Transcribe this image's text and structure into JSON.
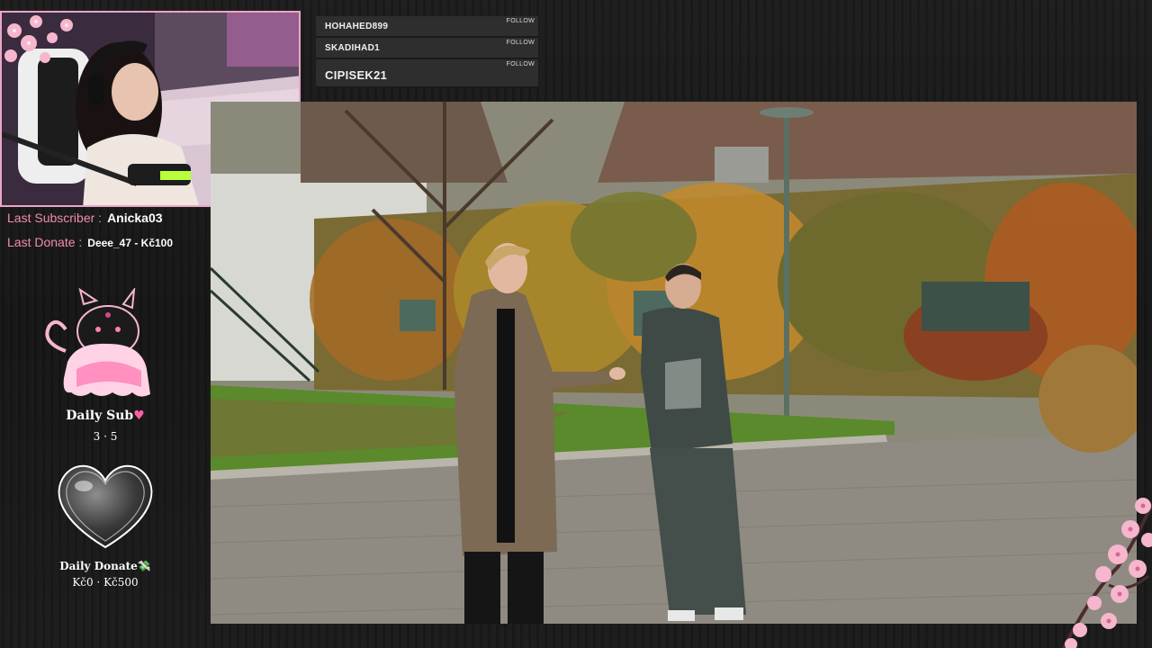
{
  "stream_labels": {
    "last_subscriber_label": "Last Subscriber :",
    "last_subscriber_value": "Anicka03",
    "last_donate_label": "Last Donate :",
    "last_donate_value": "Deee_47 - Kč100"
  },
  "followers": [
    {
      "name": "HOHAHED899",
      "action": "FOLLOW"
    },
    {
      "name": "SKADIHAD1",
      "action": "FOLLOW"
    },
    {
      "name": "CIPISEK21",
      "action": "FOLLOW"
    }
  ],
  "daily_sub": {
    "title": "Daily Sub",
    "heart_icon": "♥",
    "value": "3 · 5"
  },
  "daily_donate": {
    "title": "Daily Donate",
    "money_icon": "💸",
    "value": "Kč0 · Kč500"
  },
  "colors": {
    "accent_pink": "#f28bb3",
    "webcam_border": "#e9a6c6",
    "blossom": "#f6b6cd"
  }
}
